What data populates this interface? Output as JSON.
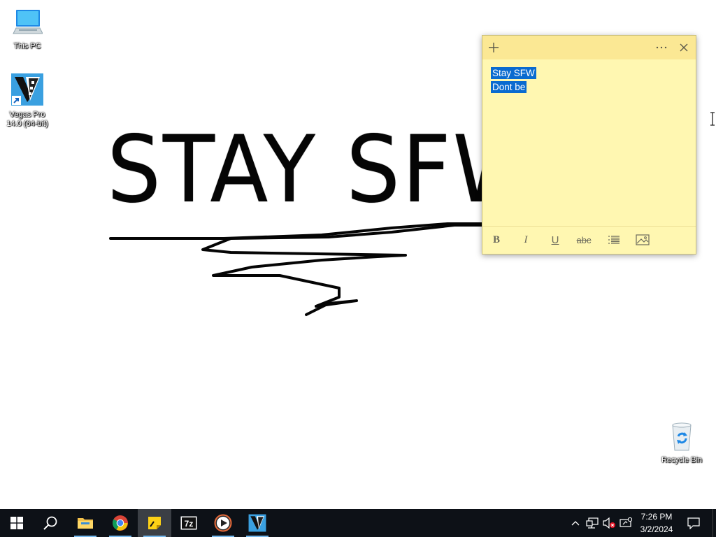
{
  "desktop": {
    "wallpaper_text": "STAY SFW",
    "icons": [
      {
        "label": "This PC",
        "icon": "this-pc-icon"
      },
      {
        "label": "Vegas Pro 14.0 (64-bit)",
        "icon": "vegas-pro-icon"
      },
      {
        "label": "Recycle Bin",
        "icon": "recycle-bin-icon"
      }
    ]
  },
  "sticky_note": {
    "lines": [
      "Stay SFW",
      "Dont be "
    ],
    "selection_color": "#0a6bd0",
    "note_color": "#fff7b1",
    "header_color": "#fbe894",
    "toolbar": {
      "bold": "B",
      "italic": "I",
      "underline": "U",
      "strikethrough": "abc"
    }
  },
  "taskbar": {
    "apps": [
      {
        "name": "Start",
        "icon": "windows-logo-icon"
      },
      {
        "name": "Search",
        "icon": "search-icon"
      },
      {
        "name": "File Explorer",
        "icon": "folder-icon",
        "open": true
      },
      {
        "name": "Google Chrome",
        "icon": "chrome-icon",
        "open": true
      },
      {
        "name": "Sticky Notes",
        "icon": "sticky-notes-icon",
        "open": true,
        "active": true
      },
      {
        "name": "7-Zip",
        "icon": "7zip-icon"
      },
      {
        "name": "Media Player",
        "icon": "media-player-icon",
        "open": true
      },
      {
        "name": "Vegas Pro",
        "icon": "vegas-pro-icon",
        "open": true
      }
    ],
    "tray": {
      "time": "7:26 PM",
      "date": "3/2/2024"
    }
  }
}
